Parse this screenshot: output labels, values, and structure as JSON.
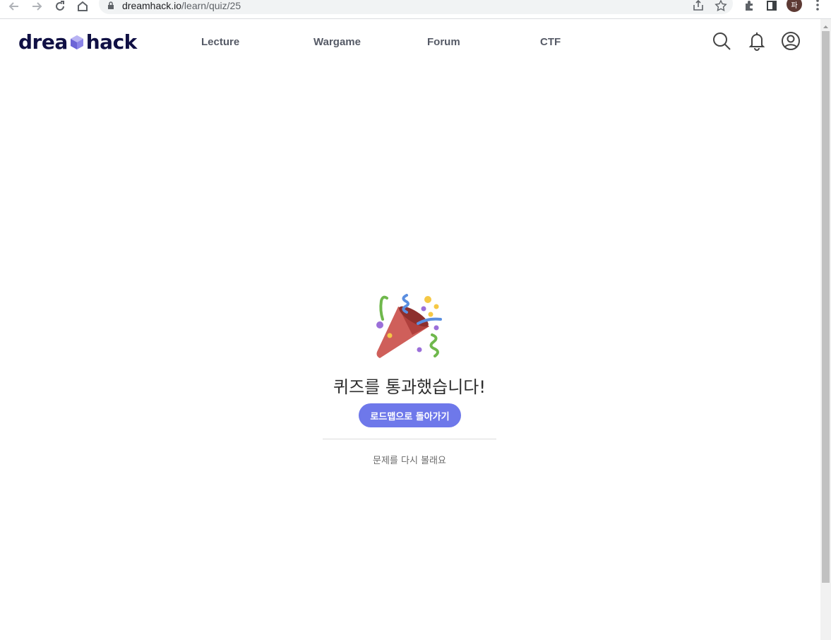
{
  "browser": {
    "url_host": "dreamhack.io",
    "url_path": "/learn/quiz/25",
    "profile_initial": "파"
  },
  "header": {
    "logo_left": "drea",
    "logo_right": "hack",
    "nav": [
      {
        "label": "Lecture"
      },
      {
        "label": "Wargame"
      },
      {
        "label": "Forum"
      },
      {
        "label": "CTF"
      }
    ]
  },
  "main": {
    "title": "퀴즈를 통과했습니다!",
    "roadmap_button": "로드맵으로 돌아가기",
    "retry_link": "문제를 다시 볼래요"
  },
  "colors": {
    "accent": "#6e78ea",
    "logo": "#101044",
    "nav_text": "#555a66"
  }
}
